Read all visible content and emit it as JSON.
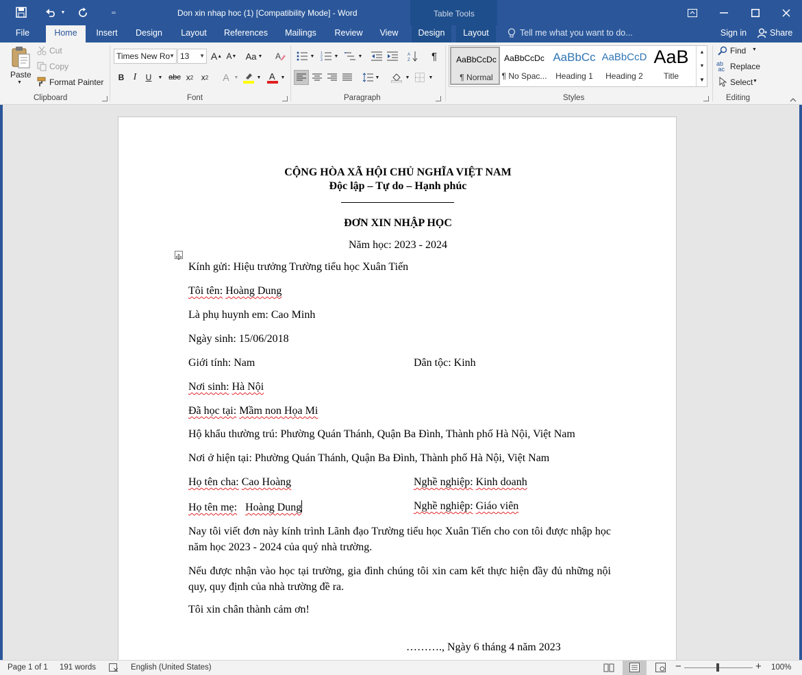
{
  "window": {
    "title": "Don xin nhap hoc (1) [Compatibility Mode] - Word",
    "context_tab_group": "Table Tools",
    "sign_in": "Sign in",
    "share": "Share"
  },
  "tabs": [
    "File",
    "Home",
    "Insert",
    "Design",
    "Layout",
    "References",
    "Mailings",
    "Review",
    "View",
    "Design",
    "Layout"
  ],
  "tell_me": "Tell me what you want to do...",
  "ribbon": {
    "clipboard": {
      "label": "Clipboard",
      "paste": "Paste",
      "cut": "Cut",
      "copy": "Copy",
      "format_painter": "Format Painter"
    },
    "font": {
      "label": "Font",
      "font_name": "Times New Ro",
      "font_size": "13"
    },
    "paragraph": {
      "label": "Paragraph"
    },
    "styles": {
      "label": "Styles",
      "items": [
        {
          "preview": "AaBbCcDc",
          "name": "¶ Normal"
        },
        {
          "preview": "AaBbCcDc",
          "name": "¶ No Spac..."
        },
        {
          "preview": "AaBbCc",
          "name": "Heading 1"
        },
        {
          "preview": "AaBbCcD",
          "name": "Heading 2"
        },
        {
          "preview": "AaB",
          "name": "Title"
        }
      ]
    },
    "editing": {
      "label": "Editing",
      "find": "Find",
      "replace": "Replace",
      "select": "Select"
    }
  },
  "document": {
    "header1": "CỘNG HÒA XÃ HỘI CHỦ NGHĨA VIỆT NAM",
    "header2": "Độc lập – Tự do – Hạnh phúc",
    "title": "ĐƠN XIN NHẬP HỌC",
    "school_year": "Năm học: 2023 - 2024",
    "to": "Kính gửi: Hiệu trưởng Trường tiểu học Xuân Tiến",
    "name": {
      "label": "Tôi tên:",
      "value": "Hoàng Dung"
    },
    "parent_of": "Là phụ huynh em: Cao Minh",
    "dob": "Ngày sinh: 15/06/2018",
    "gender": "Giới tính: Nam",
    "ethnic": "Dân tộc: Kinh",
    "birthplace": {
      "label": "Nơi sinh:",
      "value": "Hà Nội"
    },
    "studied": {
      "label": "Đã học tại:",
      "value": "Mầm non Họa Mi"
    },
    "household": "Hộ khẩu thường trú: Phường Quán Thánh, Quận Ba Đình, Thành phố Hà Nội, Việt Nam",
    "residence": "Nơi ở hiện tại: Phường Quán Thánh, Quận Ba Đình, Thành phố Hà Nội, Việt Nam",
    "father": {
      "label": "Họ tên cha:",
      "value": "Cao Hoàng"
    },
    "father_job": {
      "label": "Nghề nghiệp:",
      "value": "Kinh doanh"
    },
    "mother": {
      "label": "Họ tên mẹ:",
      "value": "Hoàng Dung"
    },
    "mother_job": {
      "label": "Nghề nghiệp:",
      "value": "Giáo viên"
    },
    "para1": "Nay tôi viết đơn này kính trình Lãnh đạo Trường tiểu học Xuân Tiến cho con tôi được nhập học năm học 2023 - 2024 của quý nhà trường.",
    "para2": "Nếu được nhận vào học tại trường, gia đình chúng tôi xin cam kết thực hiện đầy đủ những nội quy, quy định của nhà trường đề ra.",
    "thanks": "Tôi xin chân thành cảm ơn!",
    "date": "………., Ngày 6 tháng 4 năm 2023"
  },
  "status": {
    "page": "Page 1 of 1",
    "words": "191 words",
    "language": "English (United States)",
    "zoom": "100%"
  }
}
